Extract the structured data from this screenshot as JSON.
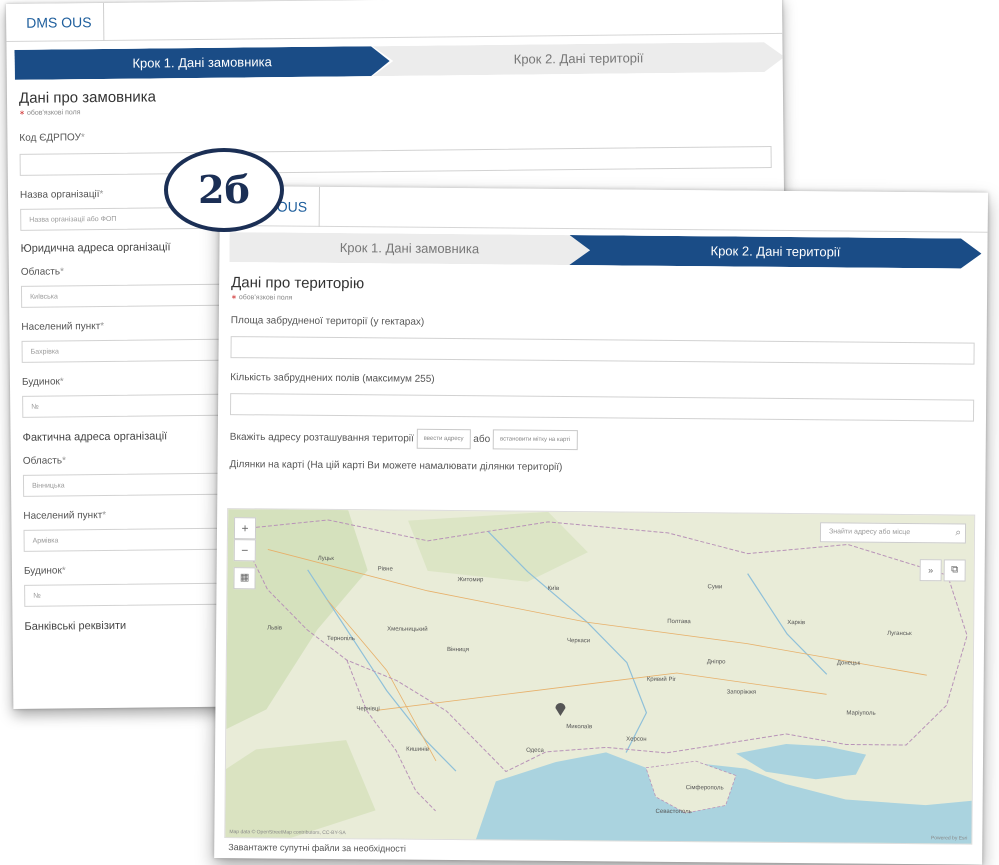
{
  "badge": "2б",
  "back": {
    "brand": "DMS OUS",
    "steps": [
      "Крок 1. Дані замовника",
      "Крок 2. Дані території"
    ],
    "section_title": "Дані про замовника",
    "req_note": "обов'язкові поля",
    "edrpou_label": "Код ЄДРПОУ",
    "org_name_label": "Назва організації",
    "org_name_placeholder": "Назва організації або ФОП",
    "legal_address_title": "Юридична адреса організації",
    "oblast_label": "Область",
    "oblast_value": "Київська",
    "settlement_label": "Населений пункт",
    "settlement_value": "Бахрівка",
    "building_label": "Будинок",
    "building_value": "№",
    "actual_address_title": "Фактична адреса організації",
    "oblast2_label": "Область",
    "oblast2_value": "Вінницька",
    "settlement2_label": "Населений пункт",
    "settlement2_value": "Армівка",
    "building2_label": "Будинок",
    "building2_value": "№",
    "bank_title": "Банківські реквізити"
  },
  "front": {
    "brand": "DMS OUS",
    "steps": [
      "Крок 1. Дані замовника",
      "Крок 2. Дані території"
    ],
    "section_title": "Дані про територію",
    "req_note": "обов'язкові поля",
    "area_label": "Площа забрудненої території (у гектарах)",
    "fields_label": "Кількість забруднених полів (максимум 255)",
    "address_prompt": "Вкажіть адресу розташування території",
    "enter_address_btn": "ввести адресу",
    "or": "або",
    "set_marker_btn": "встановити мітку на карті",
    "map_caption": "Ділянки на карті (На цій карті Ви можете намалювати ділянки території)",
    "map_search_placeholder": "Знайти адресу або місце",
    "map_attribution": "Map data © OpenStreetMap contributors, CC-BY-SA",
    "map_powered": "Powered by Esri",
    "upload_label": "Завантажте супутні файли за необхідності",
    "map_cities": [
      "Київ",
      "Луцьк",
      "Рівне",
      "Житомир",
      "Вінниця",
      "Полтава",
      "Харків",
      "Львів",
      "Тернопіль",
      "Хмельницький",
      "Черкаси",
      "Суми",
      "Дніпро",
      "Кривий Ріг",
      "Запоріжжя",
      "Миколаїв",
      "Херсон",
      "Одеса",
      "Донецьк",
      "Маріуполь",
      "Луганськ",
      "Кишинів",
      "Чернівці",
      "Севастополь",
      "Сімферополь"
    ]
  }
}
